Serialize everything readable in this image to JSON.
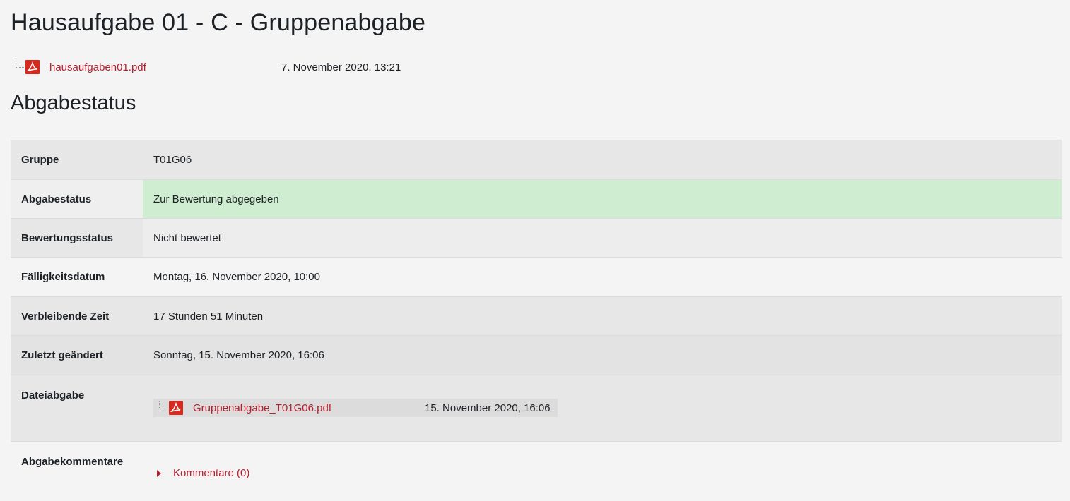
{
  "assignment": {
    "title": "Hausaufgabe 01 - C - Gruppenabgabe",
    "intro_file": {
      "name": "hausaufgaben01.pdf",
      "date": "7. November 2020, 13:21",
      "icon": "pdf-icon"
    }
  },
  "status_section": {
    "heading": "Abgabestatus",
    "rows": [
      {
        "label": "Gruppe",
        "value": "T01G06"
      },
      {
        "label": "Abgabestatus",
        "value": "Zur Bewertung abgegeben"
      },
      {
        "label": "Bewertungsstatus",
        "value": "Nicht bewertet"
      },
      {
        "label": "Fälligkeitsdatum",
        "value": "Montag, 16. November 2020, 10:00"
      },
      {
        "label": "Verbleibende Zeit",
        "value": "17 Stunden 51 Minuten"
      },
      {
        "label": "Zuletzt geändert",
        "value": "Sonntag, 15. November 2020, 16:06"
      },
      {
        "label": "Dateiabgabe",
        "file": {
          "name": "Gruppenabgabe_T01G06.pdf",
          "date": "15. November 2020, 16:06",
          "icon": "pdf-icon"
        }
      },
      {
        "label": "Abgabekommentare",
        "comments_link": "Kommentare (0)"
      }
    ]
  },
  "colors": {
    "link": "#b5202e",
    "submitted_status_bg": "#cfedd0"
  }
}
